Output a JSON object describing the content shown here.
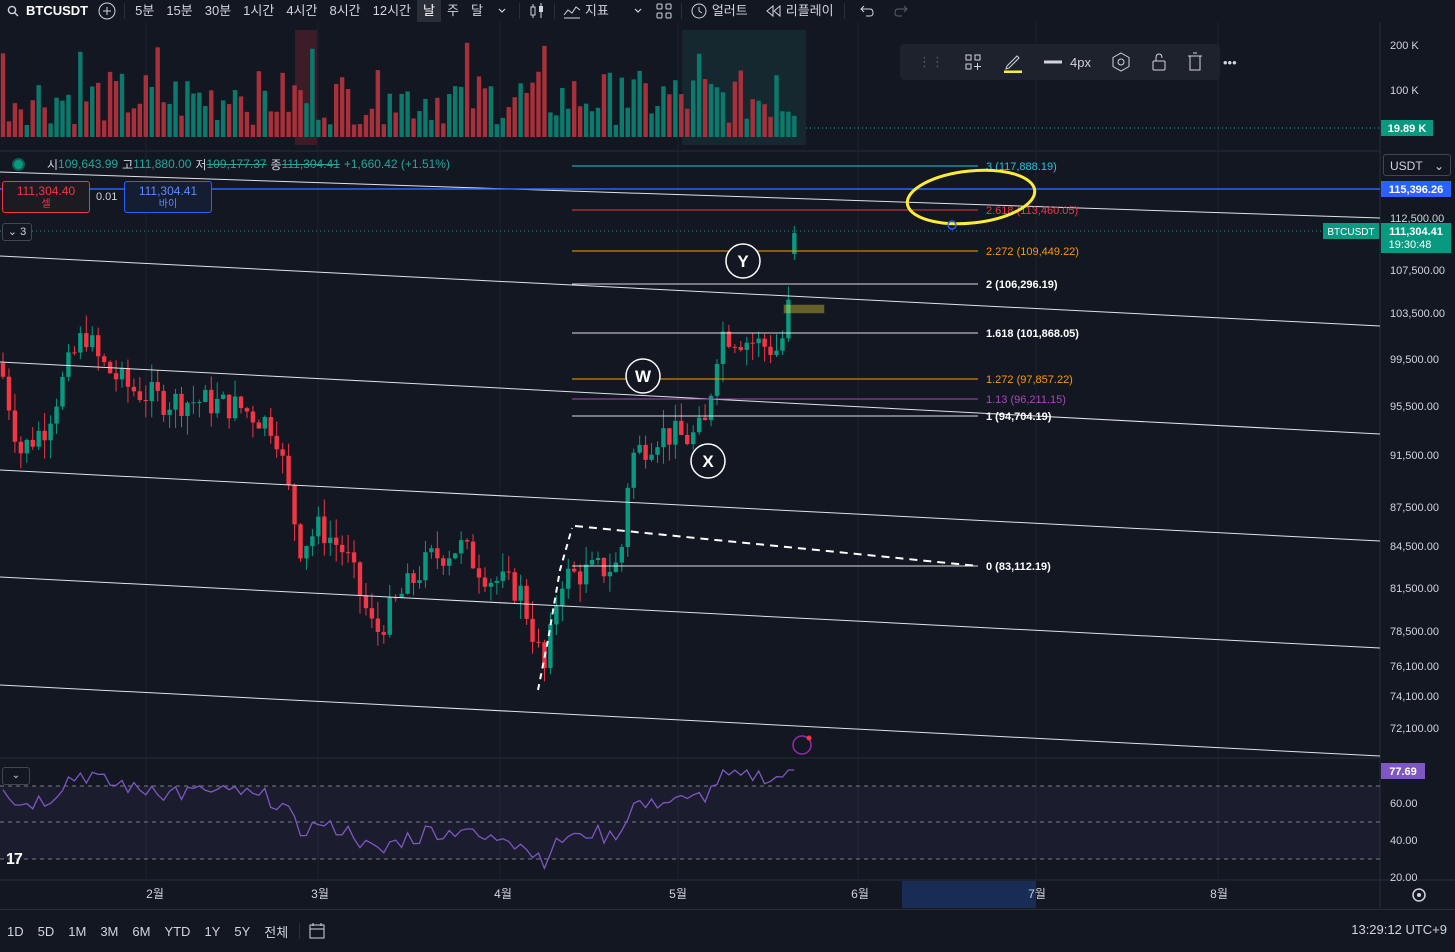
{
  "toolbar": {
    "symbol": "BTCUSDT",
    "intervals": [
      "5분",
      "15분",
      "30분",
      "1시간",
      "4시간",
      "8시간",
      "12시간",
      "날",
      "주",
      "달"
    ],
    "active_interval": "날",
    "indicators_label": "지표",
    "alert_label": "얼러트",
    "replay_label": "리플레이"
  },
  "ohlc": {
    "open_label": "시",
    "open": "109,643.99",
    "high_label": "고",
    "high": "111,880.00",
    "low_label": "저",
    "low": "109,177.37",
    "close_label": "종",
    "close": "111,304.41",
    "change": "+1,660.42 (+1.51%)"
  },
  "order": {
    "sell_price": "111,304.40",
    "sell_label": "셀",
    "qty": "0.01",
    "buy_price": "111,304.41",
    "buy_label": "바이"
  },
  "collapse_label": "3",
  "currency": "USDT",
  "draw_toolbar": {
    "width_label": "4px"
  },
  "bottom": {
    "ranges": [
      "1D",
      "5D",
      "1M",
      "3M",
      "6M",
      "YTD",
      "1Y",
      "5Y",
      "전체"
    ],
    "clock": "13:29:12 UTC+9"
  },
  "chart_data": {
    "type": "candlestick",
    "symbol": "BTCUSDT",
    "x_tick_labels": [
      "2월",
      "3월",
      "4월",
      "5월",
      "6월",
      "7월",
      "8월"
    ],
    "price_axis_labels": [
      "112,500.00",
      "107,500.00",
      "103,500.00",
      "99,500.00",
      "95,500.00",
      "91,500.00",
      "87,500.00",
      "84,500.00",
      "81,500.00",
      "78,500.00",
      "76,100.00",
      "74,100.00",
      "72,100.00"
    ],
    "volume_axis_labels": [
      "200 K",
      "100 K"
    ],
    "volume_last": "19.89 K",
    "rsi_axis_labels": [
      "60.00",
      "40.00",
      "20.00"
    ],
    "rsi_last": "77.69",
    "last_price_tag": {
      "symbol": "BTCUSDT",
      "price": "111,304.41",
      "countdown": "19:30:48"
    },
    "horizontal_line_price": "115,396.26",
    "fib_levels": [
      {
        "label": "3 (117,888.19)",
        "color": "#26c6da"
      },
      {
        "label": "2.618 (113,460.05)",
        "color": "#f23645"
      },
      {
        "label": "2.272 (109,449.22)",
        "color": "#ff9800"
      },
      {
        "label": "2 (106,296.19)",
        "color": "#ffffff"
      },
      {
        "label": "1.618 (101,868.05)",
        "color": "#ffffff"
      },
      {
        "label": "1.272 (97,857.22)",
        "color": "#ff9800"
      },
      {
        "label": "1.13 (96,211.15)",
        "color": "#ab47bc"
      },
      {
        "label": "1 (94,704.19)",
        "color": "#ffffff"
      },
      {
        "label": "0 (83,112.19)",
        "color": "#ffffff"
      }
    ],
    "wave_labels": [
      "W",
      "X",
      "Y"
    ],
    "colors": {
      "up": "#089981",
      "down": "#f23645",
      "background": "#131722",
      "highlight": "#ffeb3b"
    }
  }
}
